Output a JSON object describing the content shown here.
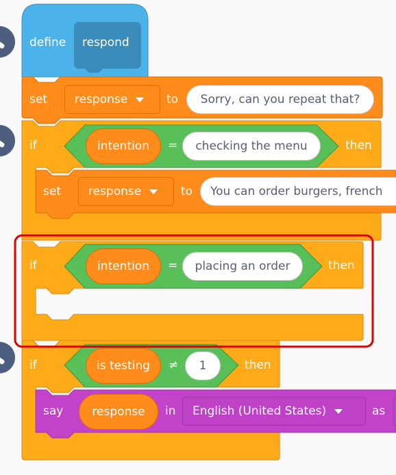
{
  "colors": {
    "define_block": "#4cb2ea",
    "define_dark": "#3a8dbb",
    "control_block": "#ffab19",
    "control_dark": "#cf8b17",
    "variable_block": "#ff8c1a",
    "operator_block": "#59c059",
    "operator_dark": "#389438",
    "sound_block": "#c242c9",
    "highlight_border": "#dd0000",
    "wrench_badge": "#4c5f81"
  },
  "define_block": {
    "keyword": "define",
    "name": "respond"
  },
  "set_block_1": {
    "keyword": "set",
    "variable": "response",
    "to": "to",
    "value": "Sorry, can you repeat that?"
  },
  "if_block_1": {
    "keyword": "if",
    "left": "intention",
    "op": "=",
    "right": "checking the menu",
    "then": "then",
    "inner_set": {
      "keyword": "set",
      "variable": "response",
      "to": "to",
      "value": "You can order burgers, french"
    }
  },
  "if_block_2": {
    "keyword": "if",
    "left": "intention",
    "op": "=",
    "right": "placing an order",
    "then": "then"
  },
  "if_block_3": {
    "keyword": "if",
    "left": "is testing",
    "op": "≠",
    "right": "1",
    "then": "then",
    "say": {
      "keyword": "say",
      "value": "response",
      "in": "in",
      "language": "English (United States)",
      "as": "as"
    }
  },
  "icons": [
    "wrench-icon",
    "dropdown-caret-icon"
  ]
}
